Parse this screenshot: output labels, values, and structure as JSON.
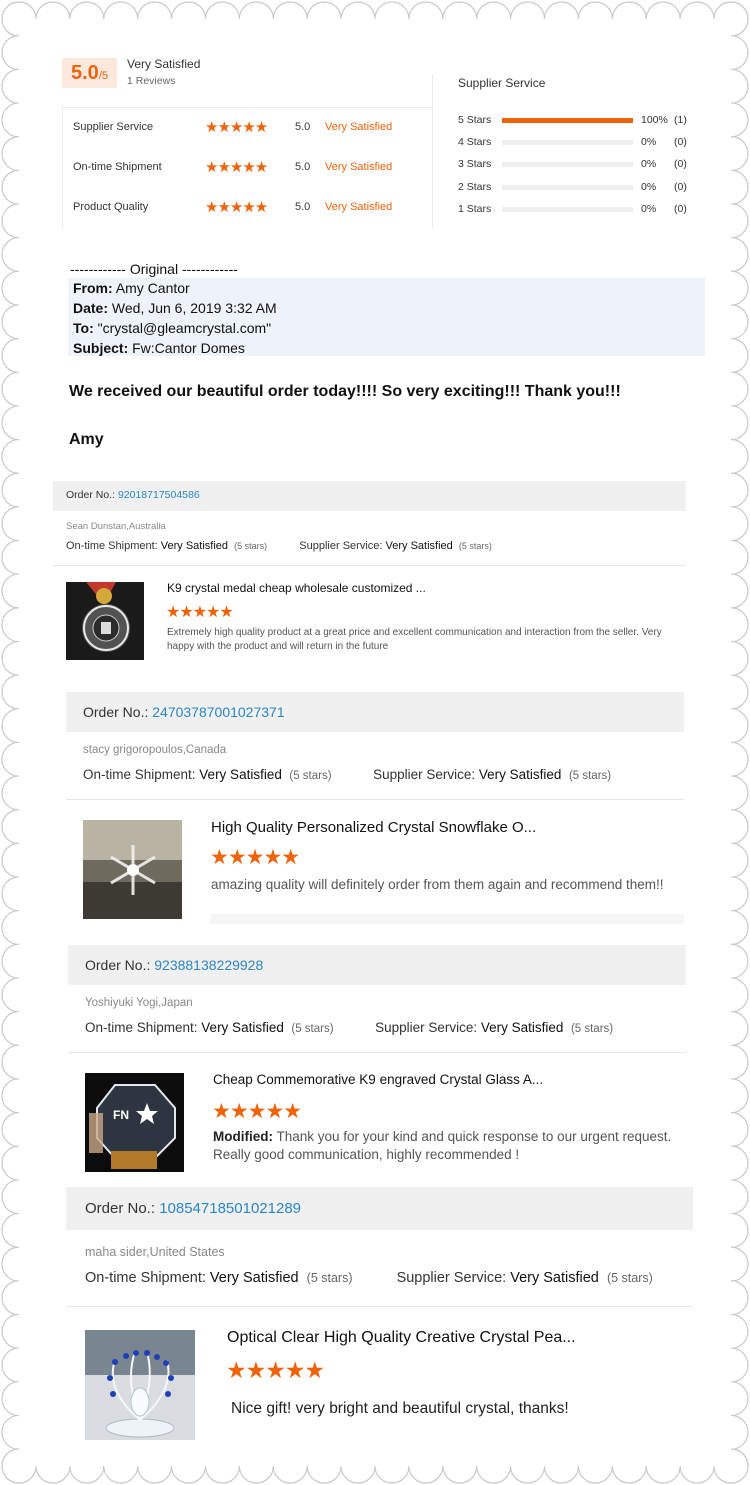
{
  "summary": {
    "score": "5.0",
    "score_max": "/5",
    "rating_label": "Very Satisfied",
    "reviews_count": "1 Reviews",
    "metrics": [
      {
        "label": "Supplier Service",
        "stars": "★★★★★",
        "score": "5.0",
        "rating": "Very Satisfied"
      },
      {
        "label": "On-time Shipment",
        "stars": "★★★★★",
        "score": "5.0",
        "rating": "Very Satisfied"
      },
      {
        "label": "Product Quality",
        "stars": "★★★★★",
        "score": "5.0",
        "rating": "Very Satisfied"
      }
    ],
    "distribution_title": "Supplier Service",
    "distribution": [
      {
        "label": "5 Stars",
        "percent": "100%",
        "count": "(1)",
        "fill": 1.0
      },
      {
        "label": "4 Stars",
        "percent": "0%",
        "count": "(0)",
        "fill": 0
      },
      {
        "label": "3 Stars",
        "percent": "0%",
        "count": "(0)",
        "fill": 0
      },
      {
        "label": "2 Stars",
        "percent": "0%",
        "count": "(0)",
        "fill": 0
      },
      {
        "label": "1 Stars",
        "percent": "0%",
        "count": "(0)",
        "fill": 0
      }
    ]
  },
  "email": {
    "header_line": "------------ Original ------------",
    "from_label": "From:",
    "from_value": " Amy Cantor",
    "date_label": "Date:",
    "date_value": " Wed, Jun 6, 2019 3:32 AM",
    "to_label": "To:",
    "to_value": " \"crystal@gleamcrystal.com\"",
    "subject_label": "Subject:",
    "subject_value": " Fw:Cantor Domes",
    "message": "We received our beautiful order today!!!!  So very exciting!!!  Thank you!!!",
    "signature": "Amy"
  },
  "reviews": [
    {
      "order_label": "Order No.: ",
      "order_no": "92018717504586",
      "reviewer": "Sean Dunstan,Australia",
      "shipment_label": "On-time Shipment: ",
      "shipment_value": "Very Satisfied",
      "shipment_stars": "(5 stars)",
      "service_label": "Supplier Service: ",
      "service_value": "Very Satisfied",
      "service_stars": "(5 stars)",
      "product_title": "K9 crystal medal cheap wholesale customized ...",
      "stars": "★★★★★",
      "text": "Extremely high quality product at a great price and excellent communication and interaction from  the seller. Very happy with the product and will return in the future"
    },
    {
      "order_label": "Order No.: ",
      "order_no": "24703787001027371",
      "reviewer": "stacy grigoropoulos,Canada",
      "shipment_label": "On-time Shipment: ",
      "shipment_value": "Very Satisfied",
      "shipment_stars": "(5 stars)",
      "service_label": "Supplier Service: ",
      "service_value": "Very Satisfied",
      "service_stars": "(5 stars)",
      "product_title": "High Quality Personalized Crystal Snowflake O...",
      "stars": "★★★★★",
      "text": "amazing quality will definitely order from them again and recommend them!!"
    },
    {
      "order_label": "Order No.: ",
      "order_no": "92388138229928",
      "reviewer": "Yoshiyuki Yogi,Japan",
      "shipment_label": "On-time Shipment: ",
      "shipment_value": "Very Satisfied",
      "shipment_stars": "(5 stars)",
      "service_label": "Supplier Service: ",
      "service_value": "Very Satisfied",
      "service_stars": "(5 stars)",
      "product_title": "Cheap Commemorative K9 engraved Crystal Glass A...",
      "stars": "★★★★★",
      "modified_label": "Modified:",
      "text": " Thank you for your kind and quick response to our urgent request. Really good communication, highly recommended !"
    },
    {
      "order_label": "Order No.: ",
      "order_no": "10854718501021289",
      "reviewer": "maha sider,United States",
      "shipment_label": "On-time Shipment: ",
      "shipment_value": "Very Satisfied",
      "shipment_stars": "(5 stars)",
      "service_label": "Supplier Service: ",
      "service_value": "Very Satisfied",
      "service_stars": "(5 stars)",
      "product_title": "Optical Clear High Quality Creative Crystal Pea...",
      "stars": "★★★★★",
      "text": "Nice gift! very bright and beautiful crystal, thanks!"
    }
  ],
  "colors": {
    "accent": "#f0630a",
    "link": "#2a86c9",
    "bar_bg": "#f0f0f0",
    "email_bg": "#eef3fa"
  }
}
